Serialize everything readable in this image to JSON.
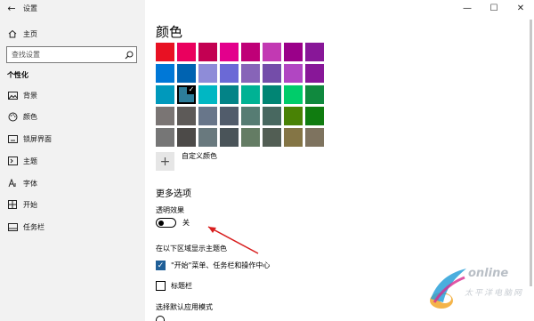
{
  "window": {
    "title": "设置",
    "controls": {
      "minimize": "—",
      "maximize": "☐",
      "close": "✕"
    }
  },
  "sidebar": {
    "back_glyph": "←",
    "home_label": "主页",
    "search_placeholder": "查找设置",
    "section": "个性化",
    "items": [
      {
        "label": "背景",
        "icon": "image-icon"
      },
      {
        "label": "颜色",
        "icon": "palette-icon"
      },
      {
        "label": "锁屏界面",
        "icon": "lock-screen-icon"
      },
      {
        "label": "主题",
        "icon": "theme-icon"
      },
      {
        "label": "字体",
        "icon": "font-icon"
      },
      {
        "label": "开始",
        "icon": "start-icon"
      },
      {
        "label": "任务栏",
        "icon": "taskbar-icon"
      }
    ]
  },
  "main": {
    "title": "颜色",
    "custom_color_label": "自定义颜色",
    "more_options_heading": "更多选项",
    "transparency": {
      "label": "透明效果",
      "state": "关",
      "on": false
    },
    "accent_surfaces_label": "在以下区域显示主题色",
    "checkboxes": [
      {
        "label": "\"开始\"菜单、任务栏和操作中心",
        "checked": true
      },
      {
        "label": "标题栏",
        "checked": false
      }
    ],
    "app_mode_label": "选择默认应用模式"
  },
  "swatches": [
    "#e81123",
    "#ea005e",
    "#c30052",
    "#e3008c",
    "#bf0077",
    "#c239b3",
    "#9a0089",
    "#881798",
    "#0078d7",
    "#0063b1",
    "#8e8cd8",
    "#6b69d6",
    "#8764b8",
    "#744da9",
    "#b146c2",
    "#881798",
    "#0099bc",
    "#2d7d9a",
    "#00b7c3",
    "#038387",
    "#00b294",
    "#018574",
    "#00cc6a",
    "#10893e",
    "#7a7574",
    "#5d5a58",
    "#68768a",
    "#515c6b",
    "#567c73",
    "#486860",
    "#498205",
    "#107c10",
    "#767676",
    "#4c4a48",
    "#69797e",
    "#4a5459",
    "#647c64",
    "#525e54",
    "#847545",
    "#7e735f"
  ],
  "selected_swatch_index": 17,
  "watermark": {
    "text": "online",
    "sub": "太平洋电脑网"
  }
}
